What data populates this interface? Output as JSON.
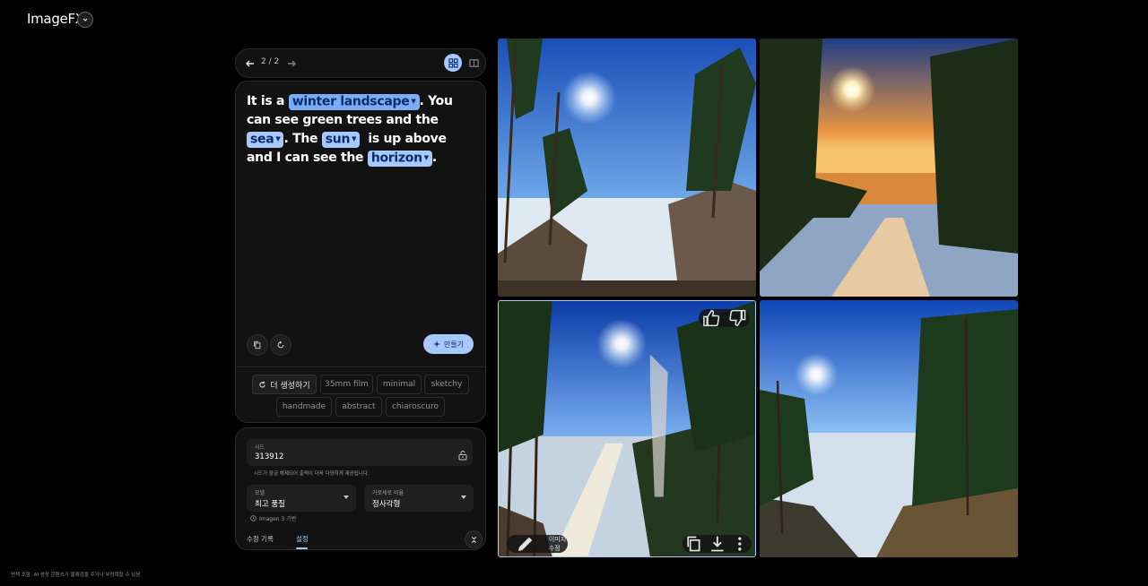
{
  "app": {
    "title": "ImageFX"
  },
  "nav": {
    "counter": "2 / 2"
  },
  "prompt": {
    "text_1": "It is a ",
    "chip_1": "winter landscape",
    "text_2": ". You can see green trees and the ",
    "chip_2": "sea",
    "text_3": ". The ",
    "chip_3": "sun",
    "text_4": "  is up above and I can see the ",
    "chip_4": "horizon",
    "text_5": "."
  },
  "actions": {
    "create_label": "만들기"
  },
  "style_chips": {
    "more": "더 생성하기",
    "items": [
      "35mm film",
      "minimal",
      "sketchy",
      "handmade",
      "abstract",
      "chiaroscuro"
    ]
  },
  "settings": {
    "seed_label": "시드",
    "seed_value": "313912",
    "seed_help": "시드가 잠금 해제되어 출력이 더욱 다양하게 제공됩니다.",
    "model_label": "모델",
    "model_value": "최고 품질",
    "aspect_label": "가로세로 비율",
    "aspect_value": "정사각형",
    "model_note": "Imagen 3 기반",
    "tab_history": "수정 기록",
    "tab_settings": "설정"
  },
  "image_toolbar": {
    "edit_label": "이미지 수정"
  },
  "footer": {
    "disclaimer": "면책 조항: AI 생성 콘텐츠가 불쾌감을 주거나 부정확할 수 있음"
  },
  "icons": [
    "arrow-back-icon",
    "arrow-forward-icon",
    "grid-view-icon",
    "single-view-icon",
    "copy-icon",
    "reset-icon",
    "sparkle-icon",
    "refresh-icon",
    "lock-open-icon",
    "info-icon",
    "collapse-icon",
    "thumb-up-icon",
    "thumb-down-icon",
    "pencil-icon",
    "download-icon",
    "more-vert-icon"
  ],
  "colors": {
    "accent": "#a8c7fa",
    "background": "#000000",
    "panel": "#121212"
  }
}
